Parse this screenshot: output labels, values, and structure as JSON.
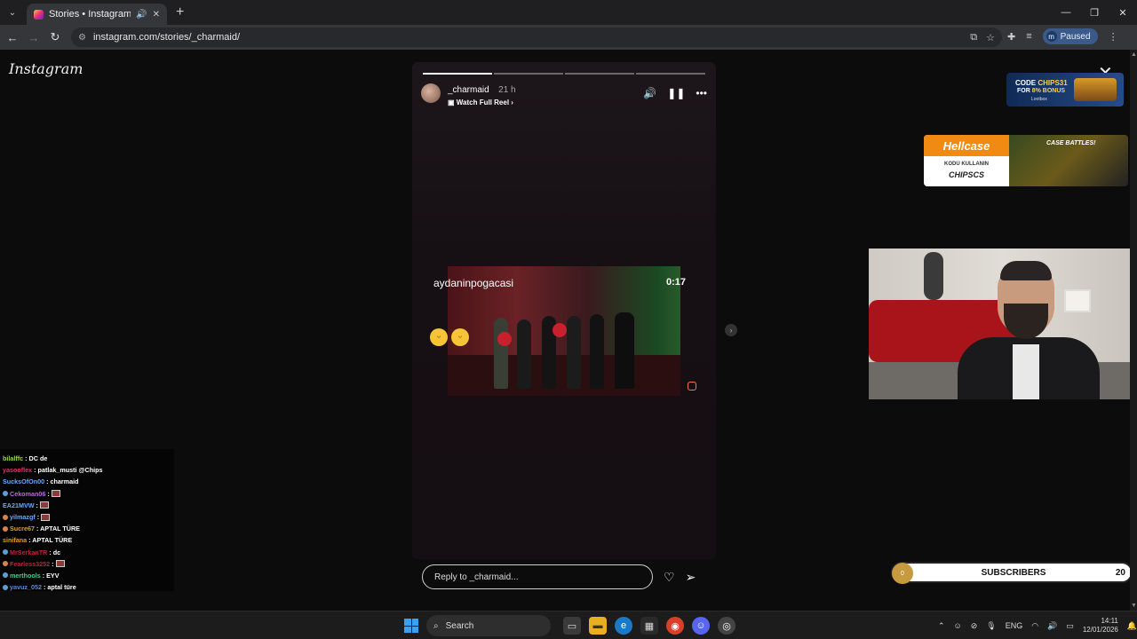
{
  "browser": {
    "tab_title": "Stories • Instagram",
    "url": "instagram.com/stories/_charmaid/",
    "profile_status": "Paused",
    "profile_initial": "m",
    "new_tab_label": "+"
  },
  "page": {
    "logo_text": "Instagram",
    "close_symbol": "✕"
  },
  "story": {
    "username": "_charmaid",
    "time_ago": "21 h",
    "reel_link": "Watch Full Reel ›",
    "progress_segments": 4,
    "progress_done": 1,
    "clip_name": "aydaninpogacasi",
    "clip_time": "0:17",
    "reply_placeholder": "Reply to _charmaid...",
    "colors": {
      "background": "#1a1216",
      "accent": "#ffffff"
    }
  },
  "overlays": {
    "ad1": {
      "code_label": "CODE",
      "code": "CHIPS31",
      "bonus_prefix": "FOR",
      "bonus": "8% BONUS",
      "brand": "Lootbox"
    },
    "ad2": {
      "brand": "Hellcase",
      "line1": "KODU KULLANIN",
      "code": "CHIPSCS",
      "right": "CASE BATTLES!"
    },
    "subs": {
      "label": "SUBSCRIBERS",
      "count": "20",
      "coin": "0"
    }
  },
  "chat": [
    {
      "user": "bilalffc",
      "color": "#9cd24a",
      "badge": "",
      "msg": ": DC de"
    },
    {
      "user": "yasooflex",
      "color": "#e0306a",
      "badge": "",
      "msg": ": patlak_musti @Chips"
    },
    {
      "user": "SucksOfOn00",
      "color": "#6aa8ff",
      "badge": "",
      "msg": ": charmaid"
    },
    {
      "user": "Cekoman06",
      "color": "#b46ad8",
      "badge": "b",
      "msg": ":",
      "emote": true
    },
    {
      "user": "EA21MVW",
      "color": "#6aa8ff",
      "badge": "",
      "msg": ":",
      "emote": true
    },
    {
      "user": "yilmazgf",
      "color": "#6aa8ff",
      "badge": "o",
      "msg": ":",
      "emote": true
    },
    {
      "user": "Sucre67",
      "color": "#e0a020",
      "badge": "o",
      "msg": ": APTAL TÜRE"
    },
    {
      "user": "sinifana",
      "color": "#e0a020",
      "badge": "",
      "msg": ": APTAL TÜRE"
    },
    {
      "user": "MrSerkanTR",
      "color": "#c02040",
      "badge": "b",
      "msg": ": dc"
    },
    {
      "user": "Fearless3252",
      "color": "#c02040",
      "badge": "o",
      "msg": ":",
      "emote": true
    },
    {
      "user": "merthools",
      "color": "#4ac88a",
      "badge": "b",
      "msg": ": EYV"
    },
    {
      "user": "yavuz_052",
      "color": "#5a8ad8",
      "badge": "b",
      "msg": ": aptal türe"
    }
  ],
  "taskbar": {
    "search_label": "Search",
    "language": "ENG",
    "time": "14:11",
    "date": "12/01/2026"
  }
}
